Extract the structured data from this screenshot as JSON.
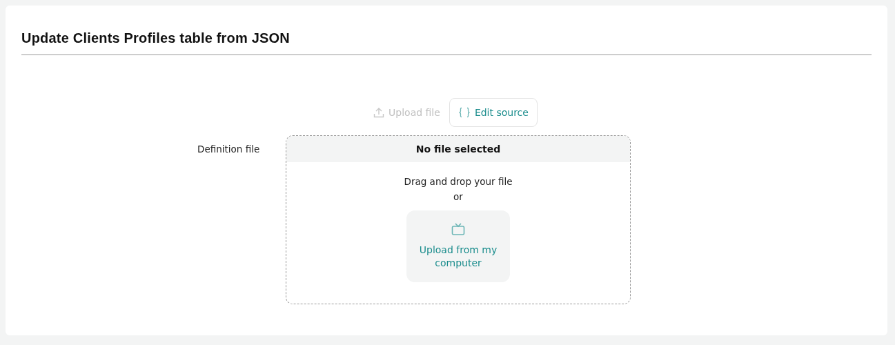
{
  "title": "Update Clients Profiles table from JSON",
  "tabs": [
    {
      "label": "Upload file",
      "selected": false,
      "kind": "upload"
    },
    {
      "label": "Edit source",
      "selected": true,
      "kind": "source"
    }
  ],
  "field": {
    "label": "Definition file",
    "status": "No file selected",
    "hint": "Drag and drop your file",
    "separator": "or",
    "button": "Upload from my computer"
  }
}
